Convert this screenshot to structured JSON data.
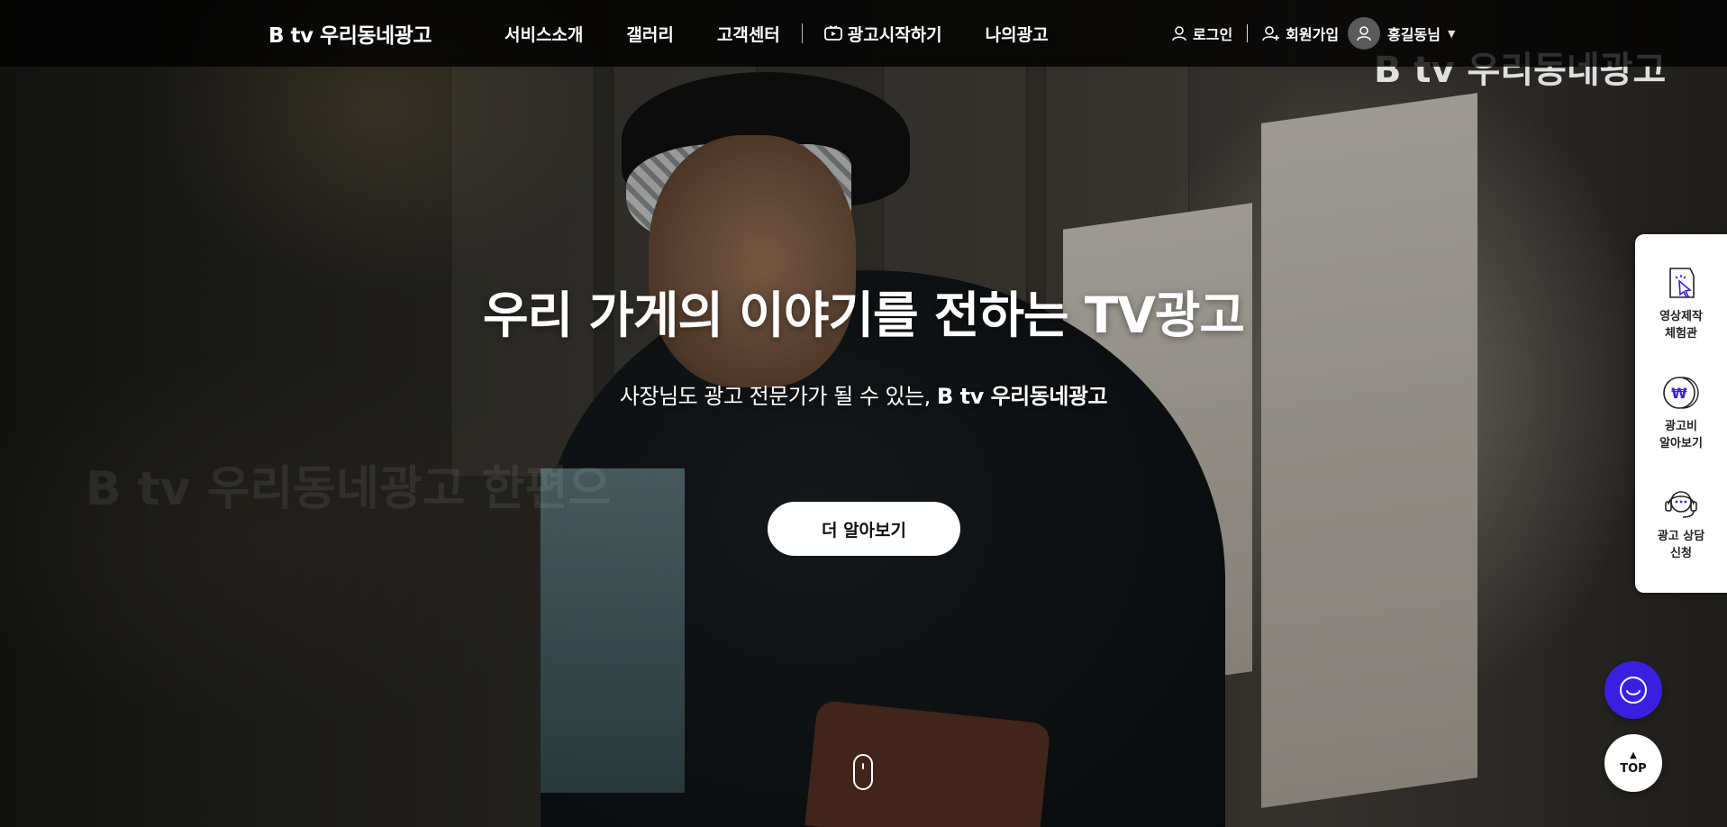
{
  "header": {
    "logo": "B tv 우리동네광고",
    "nav": [
      {
        "label": "서비스소개"
      },
      {
        "label": "갤러리"
      },
      {
        "label": "고객센터"
      },
      {
        "label": "광고시작하기"
      },
      {
        "label": "나의광고"
      }
    ],
    "user": {
      "login": "로그인",
      "signup": "회원가입",
      "username": "홍길동님"
    }
  },
  "hero": {
    "title": "우리 가게의 이야기를 전하는 TV광고",
    "subtitle_prefix": "사장님도 광고 전문가가 될 수 있는, ",
    "subtitle_brand": "B tv 우리동네광고",
    "cta": "더 알아보기",
    "watermark_left": "B tv 우리동네광고 한편으",
    "watermark_right": "B tv 우리동네광고"
  },
  "quick_menu": [
    {
      "label": "영상제작\n체험관",
      "icon": "cursor-click-icon"
    },
    {
      "label": "광고비\n알아보기",
      "icon": "won-coin-icon"
    },
    {
      "label": "광고 상담\n신청",
      "icon": "headset-icon"
    }
  ],
  "floating": {
    "top_label": "TOP",
    "chat_color": "#3b1fe0"
  }
}
